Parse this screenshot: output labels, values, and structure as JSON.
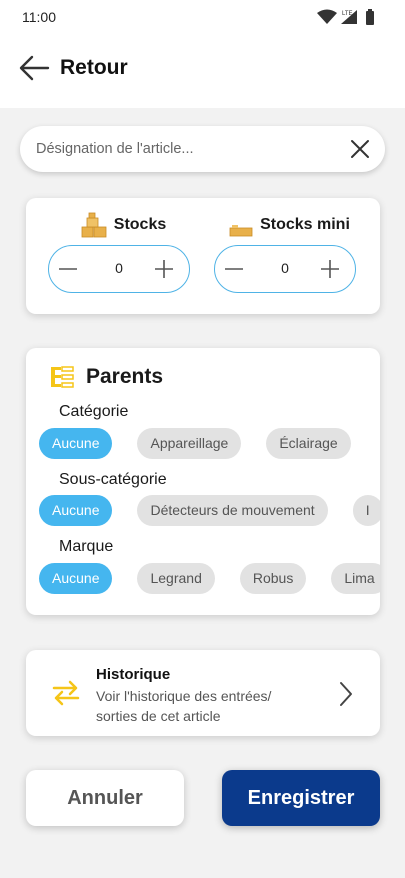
{
  "status_bar": {
    "time": "11:00",
    "network": "LTE"
  },
  "app_bar": {
    "back_label": "Retour"
  },
  "search": {
    "placeholder": "Désignation de l'article...",
    "value": ""
  },
  "stocks": {
    "stock": {
      "label": "Stocks",
      "value": "0"
    },
    "stock_min": {
      "label": "Stocks mini",
      "value": "0"
    }
  },
  "parents": {
    "title": "Parents",
    "groups": [
      {
        "label": "Catégorie",
        "chips": [
          "Aucune",
          "Appareillage",
          "Éclairage"
        ],
        "selected": "Aucune"
      },
      {
        "label": "Sous-catégorie",
        "chips": [
          "Aucune",
          "Détecteurs de mouvement",
          "I"
        ],
        "selected": "Aucune"
      },
      {
        "label": "Marque",
        "chips": [
          "Aucune",
          "Legrand",
          "Robus",
          "Lima"
        ],
        "selected": "Aucune"
      }
    ]
  },
  "history": {
    "title": "Historique",
    "subtitle": "Voir l'historique des entrées/ sorties de cet article"
  },
  "actions": {
    "cancel_label": "Annuler",
    "save_label": "Enregistrer"
  },
  "colors": {
    "accent": "#45b6ef",
    "primary": "#0b3a8c",
    "icon_yellow": "#f5c518",
    "stepper_border": "#4fb3e6"
  },
  "icons": [
    "wifi-icon",
    "signal-icon",
    "battery-icon",
    "arrow-left-icon",
    "close-icon",
    "boxes-icon",
    "box-icon",
    "minus-icon",
    "plus-icon",
    "hierarchy-icon",
    "swap-arrows-icon",
    "chevron-right-icon"
  ]
}
